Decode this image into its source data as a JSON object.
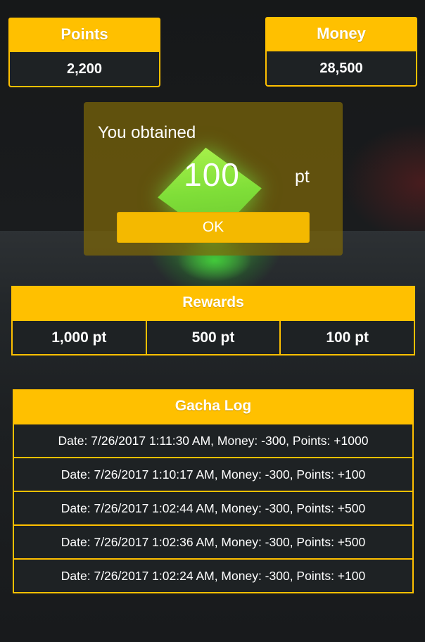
{
  "stats": {
    "points": {
      "label": "Points",
      "value": "2,200"
    },
    "money": {
      "label": "Money",
      "value": "28,500"
    }
  },
  "dialog": {
    "title": "You obtained",
    "amount": "100",
    "unit": "pt",
    "ok_label": "OK",
    "gem_color": "#8ee23f"
  },
  "rewards": {
    "title": "Rewards",
    "items": [
      "1,000 pt",
      "500 pt",
      "100 pt"
    ]
  },
  "gacha_log": {
    "title": "Gacha Log",
    "entries": [
      "Date: 7/26/2017 1:11:30 AM, Money: -300, Points: +1000",
      "Date: 7/26/2017 1:10:17 AM, Money: -300, Points: +100",
      "Date: 7/26/2017 1:02:44 AM, Money: -300, Points: +500",
      "Date: 7/26/2017 1:02:36 AM, Money: -300, Points: +500",
      "Date: 7/26/2017 1:02:24 AM, Money: -300, Points: +100"
    ]
  },
  "colors": {
    "accent": "#ffc000",
    "panel_bg": "#1e2224",
    "dialog_bg": "#7d6608"
  }
}
